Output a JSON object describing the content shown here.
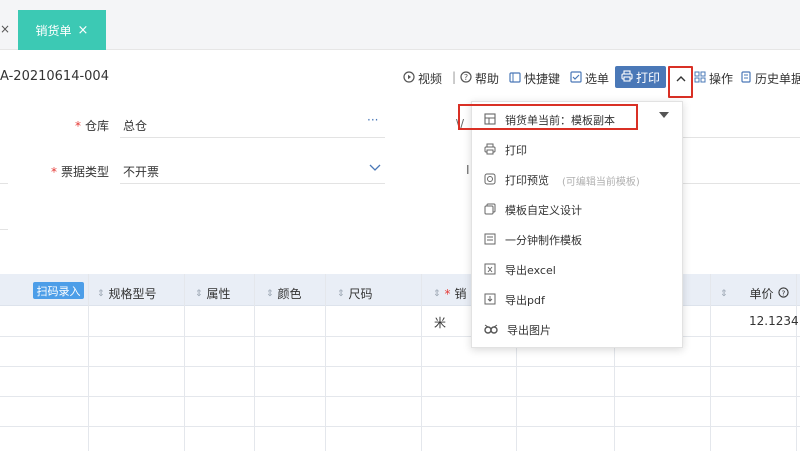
{
  "tabs": {
    "prev_close": "×",
    "active_label": "销货单",
    "active_close": "×"
  },
  "toolbar": {
    "doc_number": "A-20210614-004",
    "video": "视频",
    "separator": "|",
    "help": "帮助",
    "shortcut": "快捷键",
    "select_doc": "选单",
    "print": "打印",
    "operate": "操作",
    "history": "历史单据"
  },
  "form": {
    "warehouse_label": "仓库",
    "warehouse_value": "总仓",
    "warehouse_more": "···",
    "invoice_label": "票据类型",
    "invoice_value": "不开票",
    "right_label_fragment": "\\/",
    "right_label_fragment2": "I"
  },
  "grid": {
    "scan_button": "扫码录入",
    "headers": [
      "规格型号",
      "属性",
      "颜色",
      "尺码",
      "销"
    ],
    "price_header": "单价",
    "row1": {
      "unit": "米",
      "price": "12.1234"
    }
  },
  "print_menu": {
    "template_label": "销货单当前：模板副本",
    "items": [
      {
        "label": "打印",
        "hint": ""
      },
      {
        "label": "打印预览",
        "hint": "(可编辑当前模板)"
      },
      {
        "label": "模板自定义设计",
        "hint": ""
      },
      {
        "label": "一分钟制作模板",
        "hint": ""
      },
      {
        "label": "导出excel",
        "hint": ""
      },
      {
        "label": "导出pdf",
        "hint": ""
      },
      {
        "label": "导出图片",
        "hint": ""
      }
    ]
  },
  "colors": {
    "tab_active": "#3cc9b4",
    "print_button": "#4a78b7",
    "highlight": "#d93025",
    "scan_button": "#4d9ee8"
  }
}
